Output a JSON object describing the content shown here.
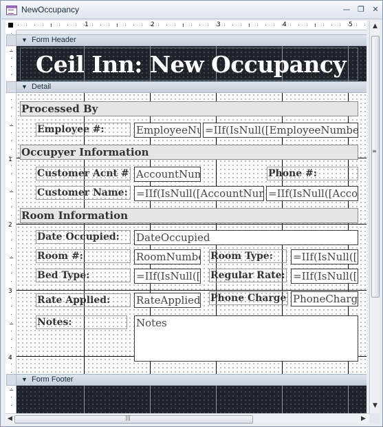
{
  "window": {
    "title": "NewOccupancy",
    "minimize_icon": "minimize-icon",
    "restore_icon": "restore-icon",
    "close_icon": "close-icon"
  },
  "ruler": {
    "top_numbers": [
      "1",
      "2",
      "3",
      "4",
      "5"
    ],
    "left_numbers": [
      "1",
      "2",
      "3",
      "4"
    ]
  },
  "sections": {
    "form_header": "Form Header",
    "detail": "Detail",
    "form_footer": "Form Footer"
  },
  "header": {
    "title": "Ceil Inn: New Occupancy"
  },
  "groups": {
    "processed_by": "Processed By",
    "occupyer_info": "Occupyer Information",
    "room_info": "Room Information"
  },
  "labels": {
    "employee": "Employee #:",
    "customer_acnt": "Customer Acnt #:",
    "phone": "Phone #:",
    "customer_name": "Customer Name:",
    "date_occupied": "Date Occupied:",
    "room_no": "Room #:",
    "room_type": "Room Type:",
    "bed_type": "Bed Type:",
    "regular_rate": "Regular Rate:",
    "rate_applied": "Rate Applied:",
    "phone_charge": "Phone Charge:",
    "notes": "Notes:"
  },
  "controls": {
    "employee_number": "EmployeeNu",
    "employee_name_expr": "=IIf(IsNull([EmployeeNumber]",
    "account_num": "AccountNum",
    "phone_expr": "",
    "customer_name_expr": "=IIf(IsNull([AccountNumb",
    "customer_name_expr2": "=IIf(IsNull([Accou",
    "date_occupied": "DateOccupied",
    "room_number": "RoomNumbe",
    "room_type_expr": "=IIf(IsNull([R",
    "bed_type_expr": "=IIf(IsNull([R",
    "regular_rate_expr": "=IIf(IsNull([R",
    "rate_applied": "RateApplied",
    "phone_charge": "PhoneCharge",
    "notes": "Notes"
  }
}
